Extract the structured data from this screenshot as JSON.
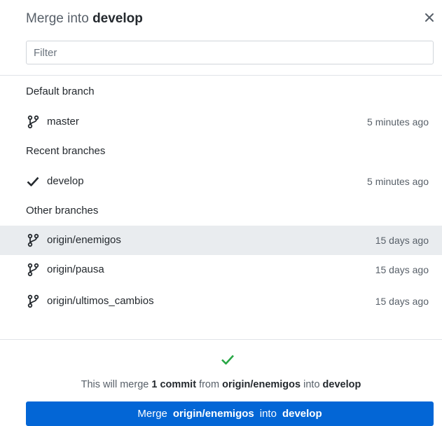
{
  "dialog": {
    "title_prefix": "Merge into",
    "title_branch": "develop",
    "close_icon": "close-icon"
  },
  "filter": {
    "placeholder": "Filter",
    "value": ""
  },
  "sections": {
    "default": {
      "label": "Default branch",
      "items": [
        {
          "name": "master",
          "time": "5 minutes ago",
          "icon": "git-branch-icon"
        }
      ]
    },
    "recent": {
      "label": "Recent branches",
      "items": [
        {
          "name": "develop",
          "time": "5 minutes ago",
          "icon": "check-icon"
        }
      ]
    },
    "other": {
      "label": "Other branches",
      "items": [
        {
          "name": "origin/enemigos",
          "time": "15 days ago",
          "icon": "git-branch-icon",
          "selected": true
        },
        {
          "name": "origin/pausa",
          "time": "15 days ago",
          "icon": "git-branch-icon"
        },
        {
          "name": "origin/ultimos_cambios",
          "time": "15 days ago",
          "icon": "git-branch-icon"
        }
      ]
    }
  },
  "summary": {
    "prefix": "This will merge",
    "count": "1 commit",
    "from": "from",
    "source": "origin/enemigos",
    "into": "into",
    "target": "develop",
    "status_icon": "success-check-icon"
  },
  "merge_button": {
    "prefix": "Merge",
    "source": "origin/enemigos",
    "into": "into",
    "target": "develop"
  },
  "colors": {
    "accent": "#0366d6",
    "success": "#28a745",
    "selected_row": "#e9ecef"
  }
}
